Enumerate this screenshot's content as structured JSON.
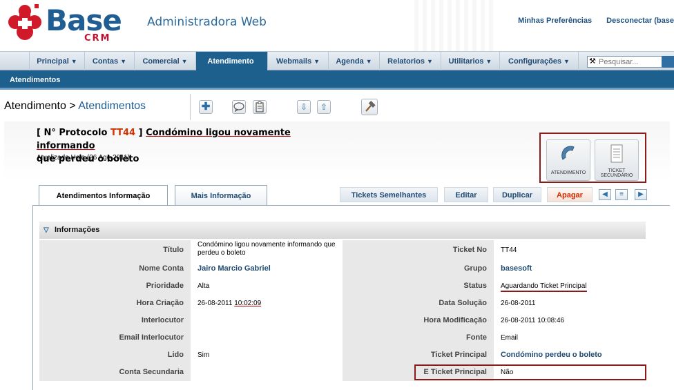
{
  "header": {
    "logo_main": "Base",
    "logo_sub": "CRM",
    "app_title": "Administradora Web",
    "links": [
      "Minhas Preferências",
      "Desconectar (base"
    ]
  },
  "nav": {
    "items": [
      {
        "label": "Principal",
        "caret": "▼"
      },
      {
        "label": "Contas",
        "caret": "▼"
      },
      {
        "label": "Comercial",
        "caret": "▼"
      },
      {
        "label": "Atendimento",
        "caret": ""
      },
      {
        "label": "Webmails",
        "caret": "▼"
      },
      {
        "label": "Agenda",
        "caret": "▼"
      },
      {
        "label": "Relatorios",
        "caret": "▼"
      },
      {
        "label": "Utilitarios",
        "caret": "▼"
      },
      {
        "label": "Configurações",
        "caret": "▼"
      }
    ],
    "search_placeholder": "Pesquisar..."
  },
  "subnav": {
    "label": "Atendimentos"
  },
  "breadcrumb": {
    "root": "Atendimento",
    "sep": " > ",
    "current": "Atendimentos"
  },
  "record": {
    "prefix": "[ N° Protocolo ",
    "protocol": "TT44",
    "mid": " ] ",
    "subject": "Condómino ligou novamente informando",
    "subject_cont": "que perdeu o boleto",
    "updated": "Atualizado Hoje (26 Ago 2011)"
  },
  "actions": {
    "atendimento": "ATENDIMENTO",
    "ticket_secundario_1": "TICKET",
    "ticket_secundario_2": "SECUNDÁRIO"
  },
  "tabs": {
    "info": "Atendimentos Informação",
    "more": "Mais Informação",
    "similar": "Tickets Semelhantes",
    "edit": "Editar",
    "duplicate": "Duplicar",
    "delete": "Apagar"
  },
  "section": {
    "title": "Informações"
  },
  "fields": {
    "titulo_label": "Título",
    "titulo_value": "Condómino ligou novamente informando que perdeu o boleto",
    "ticket_no_label": "Ticket No",
    "ticket_no_value": "TT44",
    "nome_conta_label": "Nome Conta",
    "nome_conta_value": "Jairo Marcio Gabriel",
    "grupo_label": "Grupo",
    "grupo_value": "basesoft",
    "prioridade_label": "Prioridade",
    "prioridade_value": "Alta",
    "status_label": "Status",
    "status_value": "Aguardando Ticket Principal",
    "hora_criacao_label": "Hora Criação",
    "hora_criacao_date": "26-08-2011 ",
    "hora_criacao_time": "10:02:09",
    "data_solucao_label": "Data Solução",
    "data_solucao_value": "26-08-2011",
    "interlocutor_label": "Interlocutor",
    "interlocutor_value": "",
    "hora_modificacao_label": "Hora Modificação",
    "hora_modificacao_value": "26-08-2011 10:08:46",
    "email_interlocutor_label": "Email Interlocutor",
    "email_interlocutor_value": "",
    "fonte_label": "Fonte",
    "fonte_value": "Email",
    "lido_label": "Lido",
    "lido_value": "Sim",
    "ticket_principal_label": "Ticket Principal",
    "ticket_principal_value": "Condómino perdeu o boleto",
    "conta_secundaria_label": "Conta Secundaria",
    "conta_secundaria_value": "",
    "e_ticket_principal_label": "E Ticket Principal",
    "e_ticket_principal_value": "Não"
  },
  "colors": {
    "brand": "#1f5d93",
    "accent": "#1d5f8d",
    "protocol": "#cc3300",
    "highlight": "#8b1a1a",
    "delete": "#d12a00"
  }
}
